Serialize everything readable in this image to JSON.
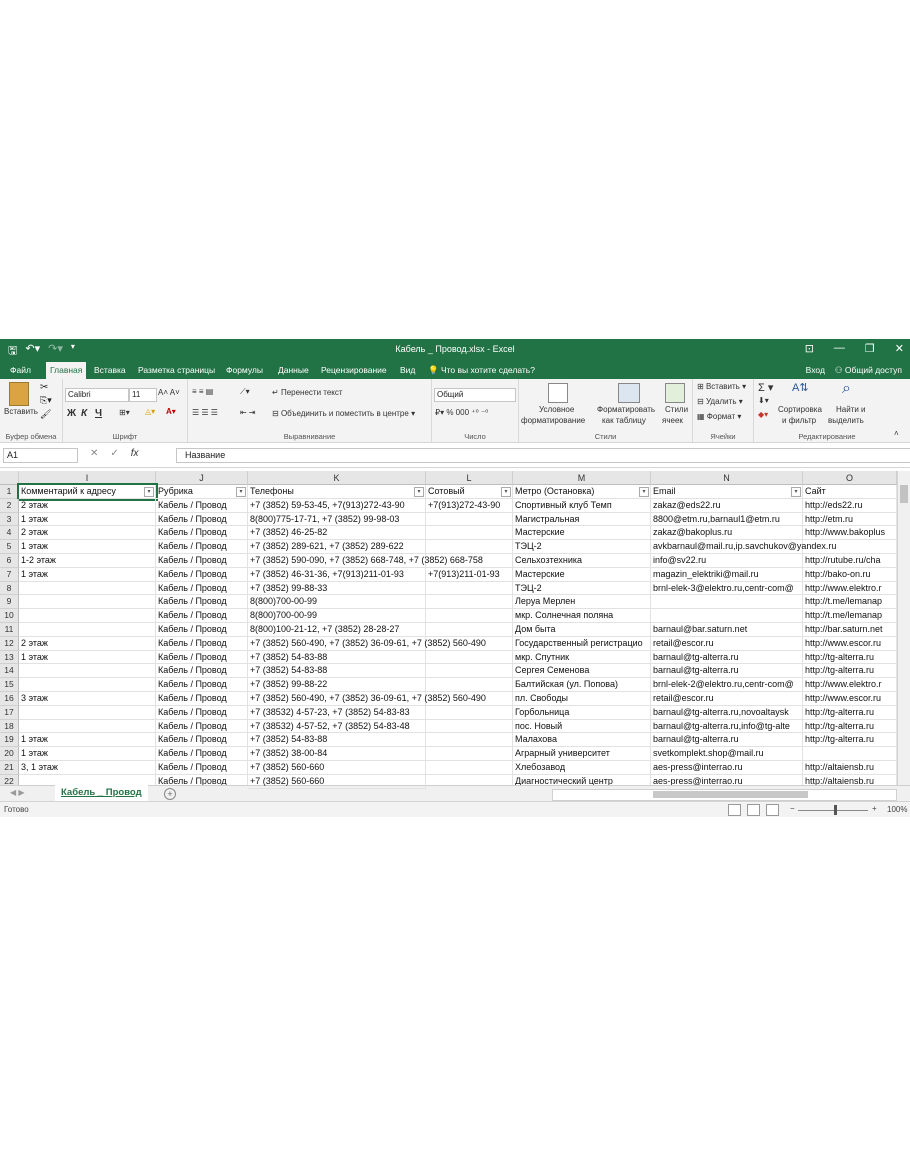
{
  "window": {
    "title": "Кабель _ Провод.xlsx - Excel"
  },
  "tabs": [
    "Файл",
    "Главная",
    "Вставка",
    "Разметка страницы",
    "Формулы",
    "Данные",
    "Рецензирование",
    "Вид"
  ],
  "tell_me": "Что вы хотите сделать?",
  "account": {
    "signin": "Вход",
    "share": "Общий доступ"
  },
  "ribbon": {
    "paste": "Вставить",
    "clipboard_group": "Буфер обмена",
    "font_name": "Calibri",
    "font_size": "11",
    "font_group": "Шрифт",
    "bold": "Ж",
    "italic": "К",
    "underline": "Ч",
    "wrap_text": "Перенести текст",
    "merge_center": "Объединить и поместить в центре",
    "alignment_group": "Выравнивание",
    "number_format": "Общий",
    "number_group": "Число",
    "cond_format_1": "Условное",
    "cond_format_2": "форматирование",
    "format_table_1": "Форматировать",
    "format_table_2": "как таблицу",
    "cell_styles_1": "Стили",
    "cell_styles_2": "ячеек",
    "styles_group": "Стили",
    "insert": "Вставить",
    "delete": "Удалить",
    "format": "Формат",
    "cells_group": "Ячейки",
    "sort_1": "Сортировка",
    "sort_2": "и фильтр",
    "find_1": "Найти и",
    "find_2": "выделить",
    "editing_group": "Редактирование"
  },
  "formula_bar": {
    "name_box": "A1",
    "fx": "fx",
    "value": "Название"
  },
  "columns": [
    "I",
    "J",
    "K",
    "L",
    "M",
    "N",
    "O"
  ],
  "headers": [
    "Комментарий к адресу",
    "Рубрика",
    "Телефоны",
    "Сотовый",
    "Метро (Остановка)",
    "Email",
    "Сайт"
  ],
  "rows": [
    [
      "1",
      "",
      "",
      "",
      "",
      "",
      "",
      ""
    ],
    [
      "2",
      "2 этаж",
      "Кабель / Провод",
      "+7 (3852) 59-53-45, +7(913)272-43-90",
      "+7(913)272-43-90",
      "Спортивный клуб Темп",
      "zakaz@eds22.ru",
      "http://eds22.ru"
    ],
    [
      "3",
      "1 этаж",
      "Кабель / Провод",
      "8(800)775-17-71, +7 (3852) 99-98-03",
      "",
      "Магистральная",
      "8800@etm.ru,barnaul1@etm.ru",
      "http://etm.ru"
    ],
    [
      "4",
      "2 этаж",
      "Кабель / Провод",
      "+7 (3852) 46-25-82",
      "",
      "Мастерские",
      "zakaz@bakoplus.ru",
      "http://www.bakoplus"
    ],
    [
      "5",
      "1 этаж",
      "Кабель / Провод",
      "+7 (3852) 289-621, +7 (3852) 289-622",
      "",
      "ТЭЦ-2",
      "avkbarnaul@mail.ru,ip.savchukov@yandex.ru",
      ""
    ],
    [
      "6",
      "1-2 этаж",
      "Кабель / Провод",
      "+7 (3852) 590-090, +7 (3852) 668-748, +7 (3852) 668-758",
      "",
      "Сельхозтехника",
      "info@sv22.ru",
      "http://rutube.ru/cha"
    ],
    [
      "7",
      "1 этаж",
      "Кабель / Провод",
      "+7 (3852) 46-31-36, +7(913)211-01-93",
      "+7(913)211-01-93",
      "Мастерские",
      "magazin_elektriki@mail.ru",
      "http://bako-on.ru"
    ],
    [
      "8",
      "",
      "Кабель / Провод",
      "+7 (3852) 99-88-33",
      "",
      "ТЭЦ-2",
      "brnl-elek-3@elektro.ru,centr-com@",
      "http://www.elektro.r"
    ],
    [
      "9",
      "",
      "Кабель / Провод",
      "8(800)700-00-99",
      "",
      "Леруа Мерлен",
      "",
      "http://t.me/lemanap"
    ],
    [
      "10",
      "",
      "Кабель / Провод",
      "8(800)700-00-99",
      "",
      "мкр. Солнечная поляна",
      "",
      "http://t.me/lemanap"
    ],
    [
      "11",
      "",
      "Кабель / Провод",
      "8(800)100-21-12, +7 (3852) 28-28-27",
      "",
      "Дом быта",
      "barnaul@bar.saturn.net",
      "http://bar.saturn.net"
    ],
    [
      "12",
      "2 этаж",
      "Кабель / Провод",
      "+7 (3852) 560-490, +7 (3852) 36-09-61, +7 (3852) 560-490",
      "",
      "Государственный регистрацио",
      "retail@escor.ru",
      "http://www.escor.ru"
    ],
    [
      "13",
      "1 этаж",
      "Кабель / Провод",
      "+7 (3852) 54-83-88",
      "",
      "мкр. Спутник",
      "barnaul@tg-alterra.ru",
      "http://tg-alterra.ru"
    ],
    [
      "14",
      "",
      "Кабель / Провод",
      "+7 (3852) 54-83-88",
      "",
      "Сергея Семенова",
      "barnaul@tg-alterra.ru",
      "http://tg-alterra.ru"
    ],
    [
      "15",
      "",
      "Кабель / Провод",
      "+7 (3852) 99-88-22",
      "",
      "Балтийская (ул. Попова)",
      "brnl-elek-2@elektro.ru,centr-com@",
      "http://www.elektro.r"
    ],
    [
      "16",
      "3 этаж",
      "Кабель / Провод",
      "+7 (3852) 560-490, +7 (3852) 36-09-61, +7 (3852) 560-490",
      "",
      "пл. Свободы",
      "retail@escor.ru",
      "http://www.escor.ru"
    ],
    [
      "17",
      "",
      "Кабель / Провод",
      "+7 (38532) 4-57-23, +7 (3852) 54-83-83",
      "",
      "Горбольница",
      "barnaul@tg-alterra.ru,novoaltaysk",
      "http://tg-alterra.ru"
    ],
    [
      "18",
      "",
      "Кабель / Провод",
      "+7 (38532) 4-57-52, +7 (3852) 54-83-48",
      "",
      "пос. Новый",
      "barnaul@tg-alterra.ru,info@tg-alte",
      "http://tg-alterra.ru"
    ],
    [
      "19",
      "1 этаж",
      "Кабель / Провод",
      "+7 (3852) 54-83-88",
      "",
      "Малахова",
      "barnaul@tg-alterra.ru",
      "http://tg-alterra.ru"
    ],
    [
      "20",
      "1 этаж",
      "Кабель / Провод",
      "+7 (3852) 38-00-84",
      "",
      "Аграрный университет",
      "svetkomplekt.shop@mail.ru",
      ""
    ],
    [
      "21",
      "3, 1 этаж",
      "Кабель / Провод",
      "+7 (3852) 560-660",
      "",
      "Хлебозавод",
      "aes-press@interrao.ru",
      "http://altaiensb.ru"
    ],
    [
      "22",
      "",
      "Кабель / Провод",
      "+7 (3852) 560-660",
      "",
      "Диагностический центр",
      "aes-press@interrao.ru",
      "http://altaiensb.ru"
    ]
  ],
  "sheet_tab": "Кабель _ Провод",
  "status": {
    "ready": "Готово",
    "zoom": "100%"
  },
  "colors": {
    "accent": "#217346"
  }
}
